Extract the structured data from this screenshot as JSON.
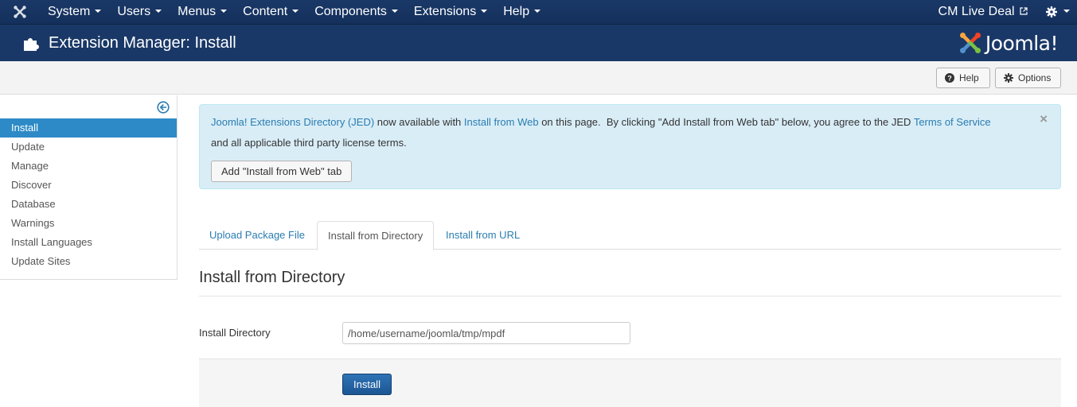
{
  "navbar": {
    "logo_icon": "joomla-logo-icon",
    "menu": [
      {
        "label": "System"
      },
      {
        "label": "Users"
      },
      {
        "label": "Menus"
      },
      {
        "label": "Content"
      },
      {
        "label": "Components"
      },
      {
        "label": "Extensions"
      },
      {
        "label": "Help"
      }
    ],
    "site_name": "CM Live Deal",
    "external_link_icon": "external-link-icon",
    "settings_icon": "gear-icon"
  },
  "header": {
    "icon": "puzzle-piece-icon",
    "title": "Extension Manager: Install",
    "brand": "Joomla!"
  },
  "toolbar": {
    "help_label": "Help",
    "options_label": "Options"
  },
  "sidebar": {
    "toggle_icon": "arrow-left-circle-icon",
    "items": [
      {
        "label": "Install",
        "active": true
      },
      {
        "label": "Update"
      },
      {
        "label": "Manage"
      },
      {
        "label": "Discover"
      },
      {
        "label": "Database"
      },
      {
        "label": "Warnings"
      },
      {
        "label": "Install Languages"
      },
      {
        "label": "Update Sites"
      }
    ]
  },
  "alert": {
    "link_jed": "Joomla! Extensions Directory (JED)",
    "text_1": " now available with ",
    "link_install_web": "Install from Web",
    "text_2": " on this page.  By clicking \"Add Install from Web tab\" below, you agree to the JED ",
    "link_tos": "Terms of Service",
    "line2": "and all applicable third party license terms.",
    "button_label": "Add \"Install from Web\" tab",
    "close": "×"
  },
  "tabs": [
    {
      "label": "Upload Package File"
    },
    {
      "label": "Install from Directory",
      "active": true
    },
    {
      "label": "Install from URL"
    }
  ],
  "form": {
    "section_title": "Install from Directory",
    "directory_label": "Install Directory",
    "directory_value": "/home/username/joomla/tmp/mpdf",
    "install_button": "Install"
  },
  "colors": {
    "navbar": "#1a3867",
    "active_item": "#2d8ac7",
    "link": "#2a7db0",
    "alert_bg": "#d9edf7"
  }
}
